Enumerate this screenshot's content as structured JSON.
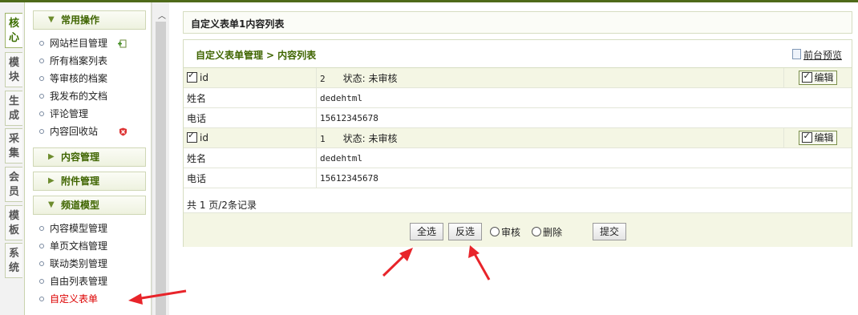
{
  "vtabs": [
    "核心",
    "模块",
    "生成",
    "采集",
    "会员",
    "模板",
    "系统"
  ],
  "menu": {
    "groups": [
      {
        "label": "常用操作"
      },
      {
        "label": "内容管理"
      },
      {
        "label": "附件管理"
      },
      {
        "label": "频道模型"
      }
    ],
    "common_items": [
      "网站栏目管理",
      "所有档案列表",
      "等审核的档案",
      "我发布的文档",
      "评论管理",
      "内容回收站"
    ],
    "channel_items": [
      "内容模型管理",
      "单页文档管理",
      "联动类别管理",
      "自由列表管理",
      "自定义表单"
    ]
  },
  "page_title": "自定义表单1内容列表",
  "breadcrumb": {
    "first": "自定义表单管理",
    "separator": ">",
    "second": "内容列表"
  },
  "preview_link": "前台预览",
  "records": [
    {
      "id_label": "id",
      "id": "2",
      "status": "状态: 未审核",
      "edit": "编辑",
      "name_label": "姓名",
      "name": "dedehtml",
      "phone_label": "电话",
      "phone": "15612345678"
    },
    {
      "id_label": "id",
      "id": "1",
      "status": "状态: 未审核",
      "edit": "编辑",
      "name_label": "姓名",
      "name": "dedehtml",
      "phone_label": "电话",
      "phone": "15612345678"
    }
  ],
  "pager": "共 1 页/2条记录",
  "actions": {
    "select_all": "全选",
    "invert": "反选",
    "approve": "审核",
    "delete": "删除",
    "submit": "提交"
  },
  "colors": {
    "accent": "#3f6500",
    "annotation": "#e8242a",
    "header_bg": "#f4f6e4"
  }
}
